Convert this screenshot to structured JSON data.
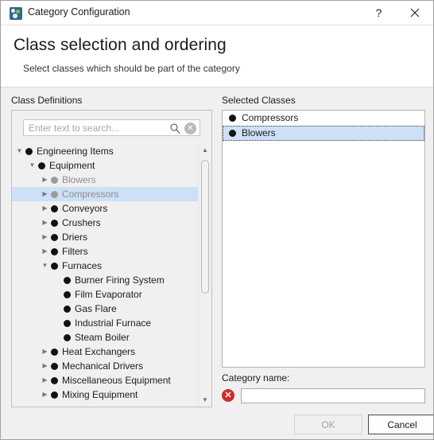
{
  "window": {
    "title": "Category Configuration",
    "icon": "app-icon",
    "help_label": "?",
    "close_label": "✕"
  },
  "header": {
    "title": "Class selection and ordering",
    "subtitle": "Select classes which should be part of the category"
  },
  "left_panel": {
    "label": "Class Definitions",
    "search": {
      "placeholder": "Enter text to search...",
      "value": "",
      "search_icon": "search-icon",
      "clear_icon": "clear-icon",
      "clear_glyph": "✕"
    },
    "scrollbar": {
      "up_glyph": "▲",
      "down_glyph": "▼"
    },
    "tree": [
      {
        "label": "Engineering Items",
        "depth": 0,
        "twisty": "expanded",
        "state": "normal",
        "selected": false
      },
      {
        "label": "Equipment",
        "depth": 1,
        "twisty": "expanded",
        "state": "normal",
        "selected": false
      },
      {
        "label": "Blowers",
        "depth": 2,
        "twisty": "collapsed",
        "state": "disabled",
        "selected": false
      },
      {
        "label": "Compressors",
        "depth": 2,
        "twisty": "collapsed",
        "state": "disabled",
        "selected": true
      },
      {
        "label": "Conveyors",
        "depth": 2,
        "twisty": "collapsed",
        "state": "normal",
        "selected": false
      },
      {
        "label": "Crushers",
        "depth": 2,
        "twisty": "collapsed",
        "state": "normal",
        "selected": false
      },
      {
        "label": "Driers",
        "depth": 2,
        "twisty": "collapsed",
        "state": "normal",
        "selected": false
      },
      {
        "label": "Filters",
        "depth": 2,
        "twisty": "collapsed",
        "state": "normal",
        "selected": false
      },
      {
        "label": "Furnaces",
        "depth": 2,
        "twisty": "expanded",
        "state": "normal",
        "selected": false
      },
      {
        "label": "Burner Firing System",
        "depth": 3,
        "twisty": "none",
        "state": "normal",
        "selected": false
      },
      {
        "label": "Film Evaporator",
        "depth": 3,
        "twisty": "none",
        "state": "normal",
        "selected": false
      },
      {
        "label": "Gas Flare",
        "depth": 3,
        "twisty": "none",
        "state": "normal",
        "selected": false
      },
      {
        "label": "Industrial Furnace",
        "depth": 3,
        "twisty": "none",
        "state": "normal",
        "selected": false
      },
      {
        "label": "Steam Boiler",
        "depth": 3,
        "twisty": "none",
        "state": "normal",
        "selected": false
      },
      {
        "label": "Heat Exchangers",
        "depth": 2,
        "twisty": "collapsed",
        "state": "normal",
        "selected": false
      },
      {
        "label": "Mechanical Drivers",
        "depth": 2,
        "twisty": "collapsed",
        "state": "normal",
        "selected": false
      },
      {
        "label": "Miscellaneous Equipment",
        "depth": 2,
        "twisty": "collapsed",
        "state": "normal",
        "selected": false
      },
      {
        "label": "Mixing Equipment",
        "depth": 2,
        "twisty": "collapsed",
        "state": "normal",
        "selected": false
      }
    ]
  },
  "right_panel": {
    "label": "Selected Classes",
    "items": [
      {
        "label": "Compressors",
        "selected": false
      },
      {
        "label": "Blowers",
        "selected": true
      }
    ]
  },
  "category": {
    "label": "Category name:",
    "value": "",
    "placeholder": "",
    "error_icon": "error-icon",
    "error_glyph": "✕"
  },
  "buttons": {
    "ok": {
      "label": "OK",
      "enabled": false
    },
    "cancel": {
      "label": "Cancel",
      "enabled": true
    }
  },
  "colors": {
    "selection": "#cde0f7",
    "error": "#d22b2b",
    "accent": "#2d6a8e",
    "window_bg": "#f0f0f0"
  }
}
